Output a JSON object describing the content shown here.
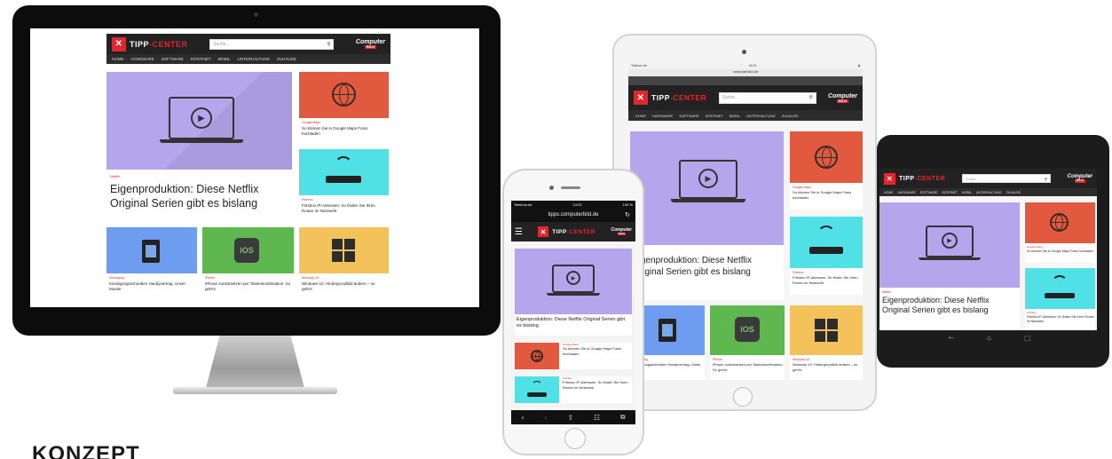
{
  "caption": "KONZEPT",
  "site": {
    "logo_mark": "✕",
    "logo_prefix": "TIPP",
    "logo_suffix": "-CENTER",
    "search_placeholder": "Suche...",
    "brand_badge": "Computer",
    "brand_badge_sub": "BILD",
    "nav": [
      "HOME",
      "HARDWARE",
      "SOFTWARE",
      "INTERNET",
      "MOBIL",
      "UNTERHALTUNG",
      "ZUHAUSE"
    ]
  },
  "colors": {
    "brand_red": "#e1262d",
    "bar_dark": "#222222",
    "hero_purple": "#b3a6ec",
    "tile_red": "#e15a3f",
    "tile_cyan": "#4fe1e6",
    "tile_blue": "#6d9cf0",
    "tile_green": "#5fb750",
    "tile_yellow": "#f3c25a"
  },
  "articles": {
    "hero": {
      "category": "Netflix",
      "title": "Eigenproduktion: Diese Netflix Original Serien gibt es bislang",
      "icon": "video-laptop-icon"
    },
    "maps": {
      "category": "Google Maps",
      "title": "So können Sie in Google Maps Fotos hochladen",
      "icon": "globe-icon"
    },
    "fritz": {
      "category": "Fritzbox",
      "title": "Fritzbox IP-Adressen: So finden Sie Ihren Router im Netzwerk",
      "icon": "router-icon"
    },
    "contract": {
      "category": "Kündigung",
      "title": "Kündigungsschreiben Handyvertrag: Unser Muster",
      "icon": "document-icon"
    },
    "iphone": {
      "category": "iPhone",
      "title": "iPhone zurücksetzen per Tastenkombination: So geht's",
      "icon": "ios-icon"
    },
    "windows": {
      "category": "Windows 10",
      "title": "Windows 10: Hintergrundbild ändern – so geht's",
      "icon": "windows-icon"
    }
  },
  "ipad_status": {
    "carrier": "Telekom.de",
    "time": "16:21",
    "url": "computerbild.de"
  },
  "phone": {
    "status_carrier": "Telekom.de",
    "status_time": "14:22",
    "status_battery": "100 %",
    "url": "tipps.computerbild.de",
    "list": [
      {
        "category": "Google Maps",
        "title": "So können Sie in Google Maps Fotos hochladen"
      },
      {
        "category": "Fritzbox",
        "title": "Fritzbox IP-Adressen: So finden Sie Ihren Router im Netzwerk"
      }
    ]
  }
}
